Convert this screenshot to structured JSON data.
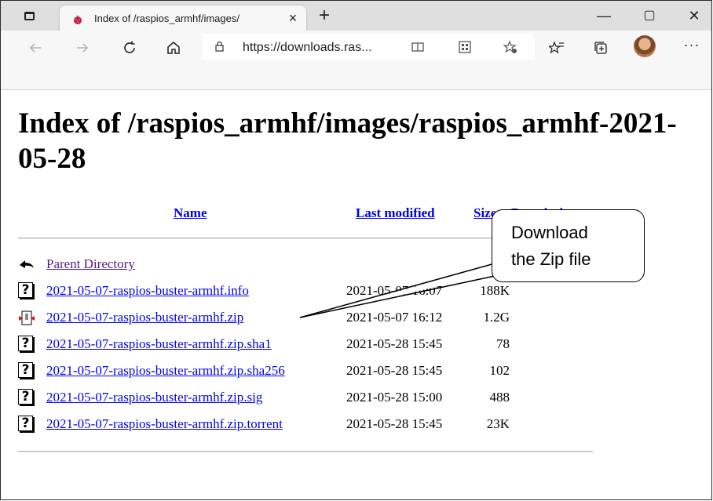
{
  "browser": {
    "tab": {
      "title": "Index of /raspios_armhf/images/",
      "close": "×"
    },
    "new_tab": "+",
    "window_controls": {
      "minimize": "—",
      "maximize": "▢",
      "close": "✕"
    },
    "url": "https://downloads.ras...",
    "more": "···"
  },
  "page": {
    "title": "Index of /raspios_armhf/images/raspios_armhf-2021-05-28",
    "columns": {
      "name": "Name",
      "last_modified": "Last modified",
      "size": "Size",
      "description": "Description"
    },
    "parent": "Parent Directory",
    "files": [
      {
        "name": "2021-05-07-raspios-buster-armhf.info",
        "modified": "2021-05-07 16:07",
        "size": "188K",
        "icon": "unknown-file-icon"
      },
      {
        "name": "2021-05-07-raspios-buster-armhf.zip",
        "modified": "2021-05-07 16:12",
        "size": "1.2G",
        "icon": "archive-file-icon"
      },
      {
        "name": "2021-05-07-raspios-buster-armhf.zip.sha1",
        "modified": "2021-05-28 15:45",
        "size": "78",
        "icon": "unknown-file-icon"
      },
      {
        "name": "2021-05-07-raspios-buster-armhf.zip.sha256",
        "modified": "2021-05-28 15:45",
        "size": "102",
        "icon": "unknown-file-icon"
      },
      {
        "name": "2021-05-07-raspios-buster-armhf.zip.sig",
        "modified": "2021-05-28 15:00",
        "size": "488",
        "icon": "unknown-file-icon"
      },
      {
        "name": "2021-05-07-raspios-buster-armhf.zip.torrent",
        "modified": "2021-05-28 15:45",
        "size": "23K",
        "icon": "unknown-file-icon"
      }
    ]
  },
  "callout": {
    "line1": "Download",
    "line2": "the Zip file"
  },
  "colors": {
    "link": "#0000ee",
    "visited": "#551a8b",
    "tabstrip": "#dfdfdf"
  }
}
